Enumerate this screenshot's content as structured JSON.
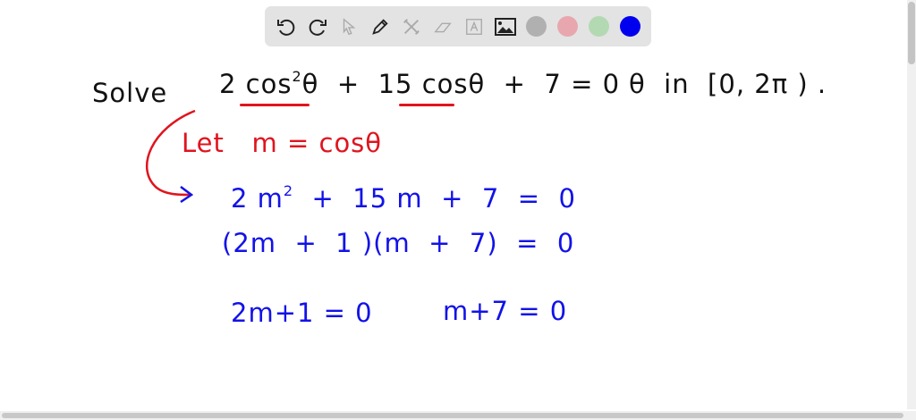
{
  "toolbar": {
    "tools": [
      "undo-icon",
      "redo-icon",
      "select-icon",
      "pen-icon",
      "tools-icon",
      "eraser-icon",
      "text-icon",
      "image-icon"
    ],
    "colors": [
      "#b0b0b0",
      "#e8a7ae",
      "#b3d9b3",
      "#0000ee"
    ]
  },
  "board": {
    "solve_label": "Solve",
    "eq_part1": "2 cos",
    "eq_sup": "2",
    "eq_part2": "θ  +  15 cosθ  +  7 = 0",
    "interval": "θ  in  [0, 2π ) .",
    "substitution": "Let   m = cosθ",
    "step1_a": "2 m",
    "step1_sup": "2",
    "step1_b": "  +  15 m  +  7  =  0",
    "step2": "(2m  +  1 )(m  +  7)  =  0",
    "step3_left": "2m+1 = 0",
    "step3_right": "m+7 = 0"
  },
  "colors": {
    "ink": "#111111",
    "red": "#e0141e",
    "blue": "#1212e8"
  }
}
